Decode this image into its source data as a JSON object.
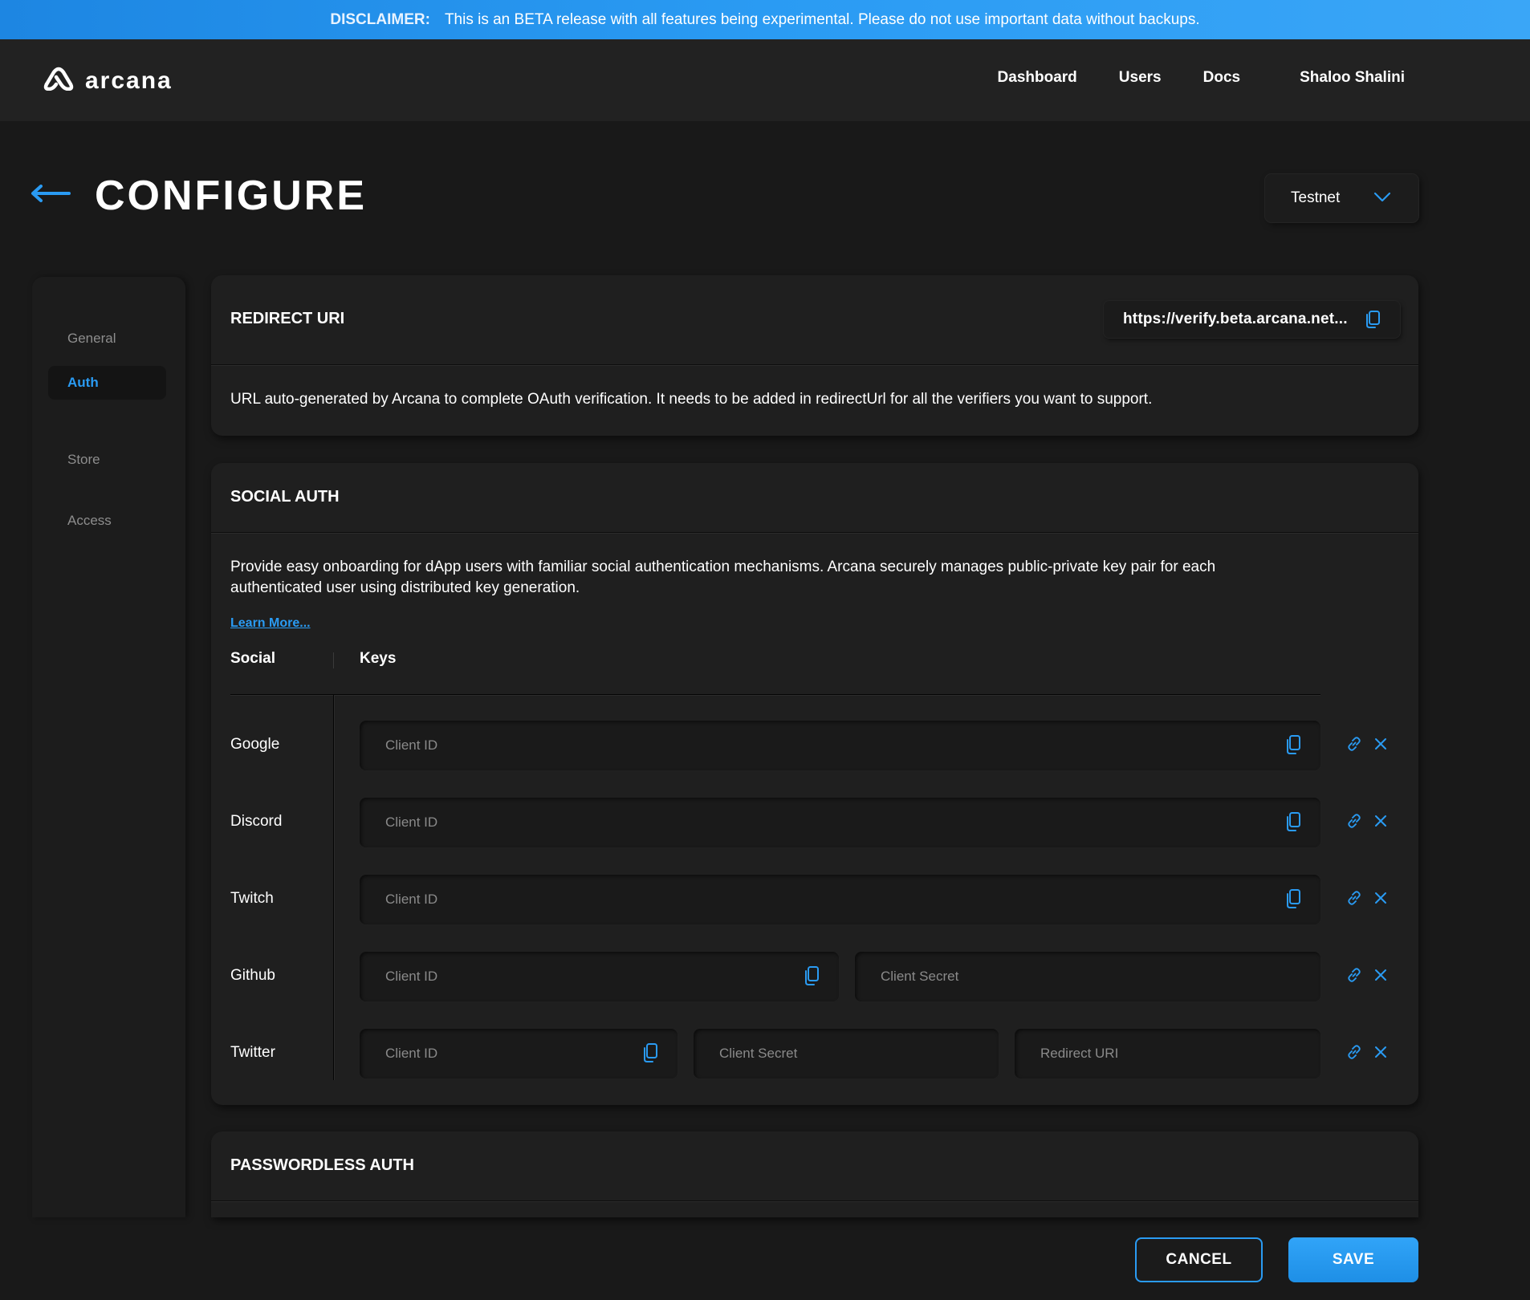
{
  "disclaimer": {
    "label": "DISCLAIMER:",
    "text": "This is an BETA release with all features being experimental. Please do not use important data without backups."
  },
  "header": {
    "logo_text": "arcana",
    "nav": [
      "Dashboard",
      "Users",
      "Docs"
    ],
    "user_name": "Shaloo Shalini"
  },
  "page": {
    "title": "CONFIGURE",
    "network": "Testnet"
  },
  "sidebar": {
    "items": [
      {
        "label": "General",
        "active": false
      },
      {
        "label": "Auth",
        "active": true
      },
      {
        "label": "Store",
        "active": false
      },
      {
        "label": "Access",
        "active": false
      }
    ]
  },
  "redirect": {
    "title": "REDIRECT URI",
    "uri": "https://verify.beta.arcana.net...",
    "description": "URL auto-generated by Arcana to complete OAuth verification. It needs to be added in redirectUrl for all the verifiers you want to support."
  },
  "social": {
    "title": "SOCIAL AUTH",
    "description_line1": "Provide easy onboarding for dApp users with familiar social authentication mechanisms. Arcana securely manages public-private key pair for each",
    "description_line2": "authenticated user using distributed key generation.",
    "learn_more": "Learn More...",
    "col_social": "Social",
    "col_keys": "Keys",
    "rows": [
      {
        "name": "Google",
        "client_id_placeholder": "Client ID"
      },
      {
        "name": "Discord",
        "client_id_placeholder": "Client ID"
      },
      {
        "name": "Twitch",
        "client_id_placeholder": "Client ID"
      },
      {
        "name": "Github",
        "client_id_placeholder": "Client ID",
        "client_secret_placeholder": "Client Secret"
      },
      {
        "name": "Twitter",
        "client_id_placeholder": "Client ID",
        "client_secret_placeholder": "Client Secret",
        "redirect_uri_placeholder": "Redirect URI"
      }
    ]
  },
  "passwordless": {
    "title": "PASSWORDLESS AUTH"
  },
  "footer": {
    "cancel": "CANCEL",
    "save": "SAVE"
  },
  "colors": {
    "accent": "#2a9bf3",
    "background": "#191919",
    "card": "#1f1f1f"
  },
  "icons": [
    "arcana-logo-icon",
    "back-arrow-icon",
    "chevron-down-icon",
    "copy-icon",
    "link-icon",
    "close-icon"
  ]
}
